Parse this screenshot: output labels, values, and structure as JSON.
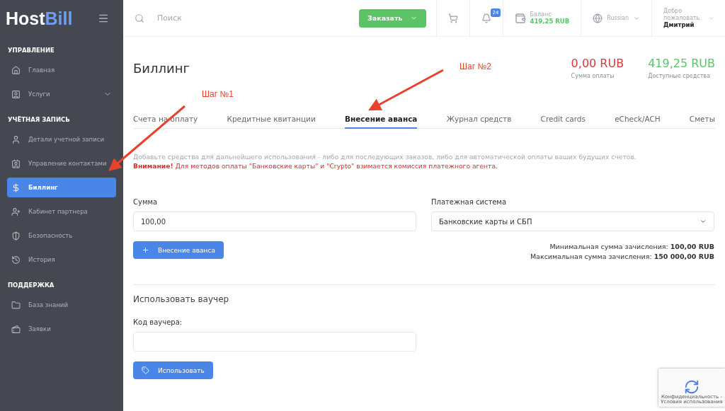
{
  "sidebar": {
    "logo": {
      "first": "Host",
      "second": "Bill"
    },
    "sections": [
      {
        "title": "УПРАВЛЕНИЕ",
        "items": [
          {
            "label": "Главная",
            "selected": false
          },
          {
            "label": "Услуги",
            "selected": false,
            "expandable": true
          }
        ]
      },
      {
        "title": "УЧЁТНАЯ ЗАПИСЬ",
        "items": [
          {
            "label": "Детали учетной записи",
            "selected": false
          },
          {
            "label": "Управление контактами",
            "selected": false
          },
          {
            "label": "Биллинг",
            "selected": true
          },
          {
            "label": "Кабинет партнера",
            "selected": false
          },
          {
            "label": "Безопасность",
            "selected": false
          },
          {
            "label": "История",
            "selected": false
          }
        ]
      },
      {
        "title": "ПОДДЕРЖКА",
        "items": [
          {
            "label": "База знаний",
            "selected": false
          },
          {
            "label": "Заявки",
            "selected": false
          }
        ]
      }
    ]
  },
  "topbar": {
    "search": {
      "placeholder": "Поиск"
    },
    "order_button": "Заказать",
    "notifications": "24",
    "balance": {
      "label": "Баланс",
      "value": "419,25 RUB"
    },
    "language": "Russian",
    "greeting": "Добро пожаловать",
    "user": "Дмитрий"
  },
  "page": {
    "title": "Биллинг",
    "stats": [
      {
        "value": "0,00 RUB",
        "label": "Сумма оплаты",
        "color": "#d9393b"
      },
      {
        "value": "419,25 RUB",
        "label": "Доступные средства",
        "color": "#5cc466"
      }
    ],
    "tabs": [
      {
        "label": "Счета на оплату",
        "selected": false
      },
      {
        "label": "Кредитные квитанции",
        "selected": false
      },
      {
        "label": "Внесение аванса",
        "selected": true
      },
      {
        "label": "Журнал средств",
        "selected": false
      },
      {
        "label": "Credit cards",
        "selected": false
      },
      {
        "label": "eCheck/ACH",
        "selected": false
      },
      {
        "label": "Сметы",
        "selected": false
      }
    ],
    "notice": "Добавьте средства для дальнейшего использования - либо для последующих заказов, либо для автоматической оплаты ваших будущих счетов.",
    "warning": "**Внимание!** Для методов оплаты \"Банковские карты\" и \"Crypto\" взимается комиссия платежного агента.",
    "deposit": {
      "amount_label": "Сумма",
      "amount_value": "100,00",
      "system_label": "Платежная система",
      "system_value": "Банковские карты и СБП",
      "button": "Внесение аванса",
      "limits": [
        "Минимальная сумма зачисления: **100,00 RUB**",
        "Максимальная сумма зачисления: **150 000,00 RUB**"
      ]
    },
    "voucher": {
      "title": "Использовать ваучер",
      "label": "Код ваучера:",
      "button": "Использовать"
    }
  },
  "recaptcha": "Конфиденциальность - Условия использования",
  "annotations": [
    {
      "label": "Шаг №1"
    },
    {
      "label": "Шаг №2"
    }
  ]
}
